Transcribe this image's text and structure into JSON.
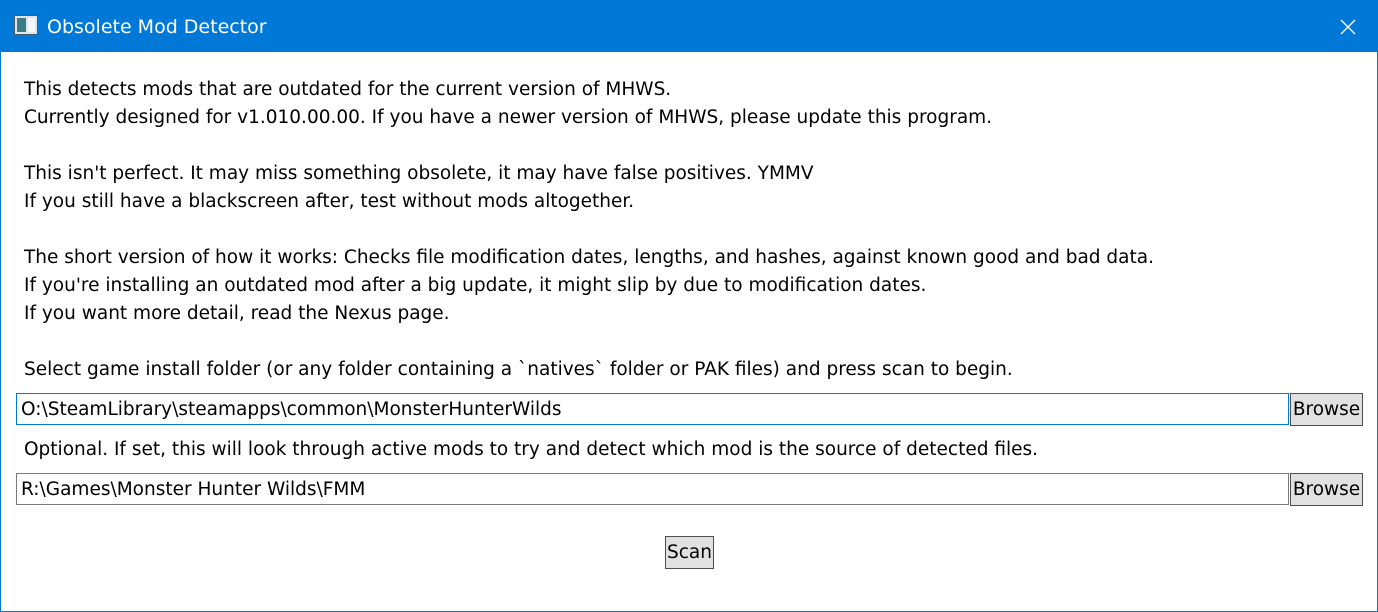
{
  "window": {
    "title": "Obsolete Mod Detector",
    "icon": "app-window-icon",
    "close_icon": "close-icon",
    "accent": "#0078d7"
  },
  "description": {
    "line1": "This detects mods that are outdated for the current version of MHWS.",
    "line2": "Currently designed for v1.010.00.00. If you have a newer version of MHWS, please update this program.",
    "line3": "This isn't perfect. It may miss something obsolete, it may have false positives. YMMV",
    "line4": "If you still have a blackscreen after, test without mods altogether.",
    "line5": "The short version of how it works: Checks file modification dates, lengths, and hashes, against known good and bad data.",
    "line6": "If you're installing an outdated mod after a big update, it might slip by due to modification dates.",
    "line7": "If you want more detail, read the Nexus page."
  },
  "game_folder": {
    "label": "Select game install folder (or any folder containing a `natives` folder or PAK files) and press scan to begin.",
    "value": "O:\\SteamLibrary\\steamapps\\common\\MonsterHunterWilds",
    "browse_label": "Browse"
  },
  "mods_folder": {
    "label": "Optional. If set, this will look through active mods to try and detect which mod is the source of detected files.",
    "value": "R:\\Games\\Monster Hunter Wilds\\FMM",
    "browse_label": "Browse"
  },
  "scan_label": "Scan"
}
